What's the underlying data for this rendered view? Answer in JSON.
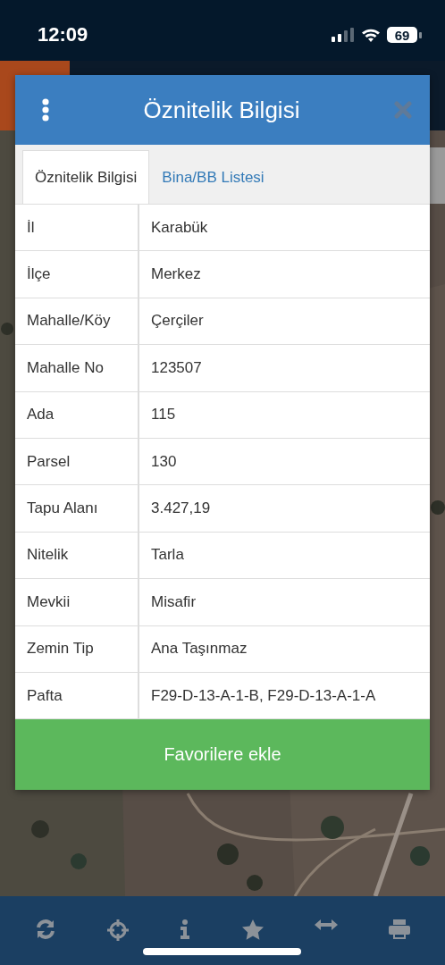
{
  "status_bar": {
    "time": "12:09",
    "battery": "69"
  },
  "dialog": {
    "title": "Öznitelik Bilgisi",
    "tabs": [
      {
        "label": "Öznitelik Bilgisi",
        "selected": true
      },
      {
        "label": "Bina/BB Listesi",
        "selected": false
      }
    ],
    "rows": [
      {
        "label": "İl",
        "value": "Karabük"
      },
      {
        "label": "İlçe",
        "value": "Merkez"
      },
      {
        "label": "Mahalle/Köy",
        "value": "Çerçiler"
      },
      {
        "label": "Mahalle No",
        "value": "123507"
      },
      {
        "label": "Ada",
        "value": "115"
      },
      {
        "label": "Parsel",
        "value": "130"
      },
      {
        "label": "Tapu Alanı",
        "value": "3.427,19"
      },
      {
        "label": "Nitelik",
        "value": "Tarla"
      },
      {
        "label": "Mevkii",
        "value": "Misafir"
      },
      {
        "label": "Zemin Tip",
        "value": "Ana Taşınmaz"
      },
      {
        "label": "Pafta",
        "value": "F29-D-13-A-1-B, F29-D-13-A-1-A"
      }
    ],
    "button": "Favorilere ekle"
  }
}
